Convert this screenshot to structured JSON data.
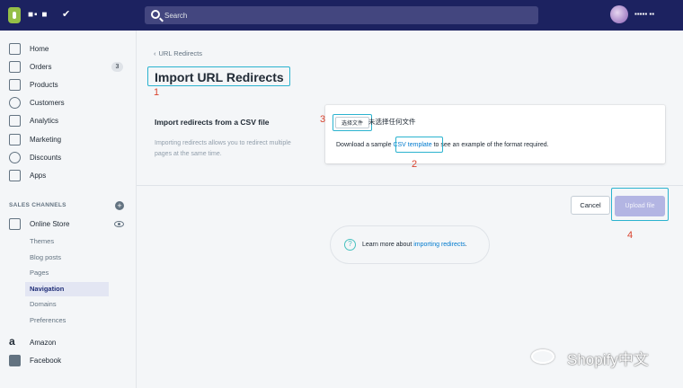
{
  "topbar": {
    "store_name": "■▪ ■",
    "search_placeholder": "Search",
    "user_name": "▪▪▪▪▪ ▪▪"
  },
  "sidebar": {
    "items": [
      {
        "label": "Home",
        "icon": "home-icon"
      },
      {
        "label": "Orders",
        "icon": "orders-icon",
        "badge": "3"
      },
      {
        "label": "Products",
        "icon": "tag-icon"
      },
      {
        "label": "Customers",
        "icon": "person-icon"
      },
      {
        "label": "Analytics",
        "icon": "chart-icon"
      },
      {
        "label": "Marketing",
        "icon": "megaphone-icon"
      },
      {
        "label": "Discounts",
        "icon": "discount-icon"
      },
      {
        "label": "Apps",
        "icon": "apps-icon"
      }
    ],
    "sales_channels_title": "SALES CHANNELS",
    "online_store": "Online Store",
    "sub_items": [
      "Themes",
      "Blog posts",
      "Pages",
      "Navigation",
      "Domains",
      "Preferences"
    ],
    "active_sub_item": "Navigation",
    "channels": [
      {
        "label": "Amazon",
        "icon": "amazon-icon"
      },
      {
        "label": "Facebook",
        "icon": "facebook-icon"
      }
    ]
  },
  "main": {
    "back_link": "URL Redirects",
    "page_title": "Import URL Redirects",
    "section_heading": "Import redirects from a CSV file",
    "section_description": "Importing redirects allows you to redirect multiple pages at the same time.",
    "file_button": "选择文件",
    "file_status": "未选择任何文件",
    "download_prefix": "Download a sample ",
    "csv_link": "CSV template",
    "download_suffix": " to see an example of the format required.",
    "cancel_button": "Cancel",
    "upload_button": "Upload file",
    "help_prefix": "Learn more about ",
    "help_link": "importing redirects",
    "help_suffix": "."
  },
  "annotations": [
    "1",
    "2",
    "3",
    "4"
  ],
  "watermark": "Shopify中文",
  "colors": {
    "topbar": "#1c2260",
    "highlight": "#2bb3cf",
    "annotation": "#d9432e",
    "link": "#007ace",
    "upload_button": "#b3b5e3"
  }
}
